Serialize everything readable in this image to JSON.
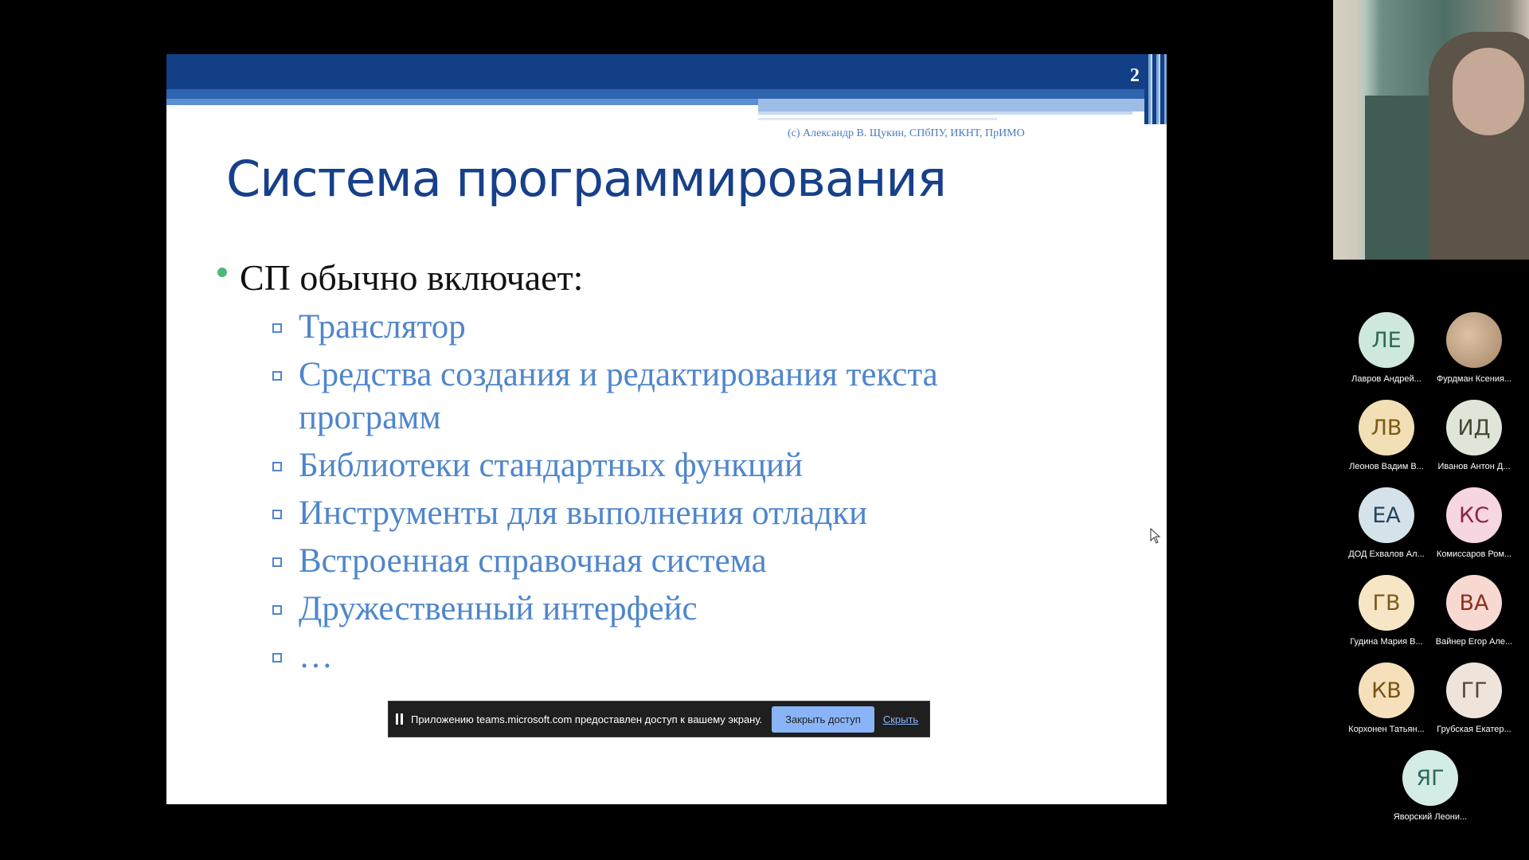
{
  "slide": {
    "number": "2",
    "copyright": "(c) Александр В. Щукин, СПбПУ, ИКНТ, ПрИМО",
    "title": "Система программирования",
    "bullet": "СП обычно включает:",
    "subitems": [
      "Транслятор",
      "Средства создания и редактирования текста программ",
      "Библиотеки стандартных функций",
      "Инструменты для выполнения отладки",
      "Встроенная справочная система",
      "Дружественный интерфейс",
      "…"
    ]
  },
  "share_banner": {
    "message": "Приложению teams.microsoft.com предоставлен доступ к вашему экрану.",
    "stop_label": "Закрыть доступ",
    "hide_label": "Скрыть"
  },
  "participants": [
    {
      "initials": "ЛЕ",
      "name": "Лавров Андрей...",
      "bg": "#cfe8dc",
      "fg": "#2c6a55"
    },
    {
      "initials": "",
      "name": "Фурдман Ксения...",
      "bg": "#c7aa8e",
      "fg": "#5a4631"
    },
    {
      "initials": "ЛВ",
      "name": "Леонов Вадим В...",
      "bg": "#f3dfb5",
      "fg": "#7a5a15"
    },
    {
      "initials": "ИД",
      "name": "Иванов Антон Д...",
      "bg": "#dfe5d8",
      "fg": "#3f4b34"
    },
    {
      "initials": "ЕА",
      "name": "ДОД Ехвалов Ал...",
      "bg": "#d6e2ea",
      "fg": "#24465e"
    },
    {
      "initials": "КС",
      "name": "Комиссаров Ром...",
      "bg": "#f6d6e0",
      "fg": "#8a2346"
    },
    {
      "initials": "ГВ",
      "name": "Гудина Мария В...",
      "bg": "#f7e6c6",
      "fg": "#7b5a1c"
    },
    {
      "initials": "ВА",
      "name": "Вайнер Егор Але...",
      "bg": "#f7d9d2",
      "fg": "#8c2f1e"
    },
    {
      "initials": "КВ",
      "name": "Корхонен Татьян...",
      "bg": "#f6e0bb",
      "fg": "#7a5316"
    },
    {
      "initials": "ГГ",
      "name": "Грубская Екатер...",
      "bg": "#eee4dc",
      "fg": "#5a4638"
    },
    {
      "initials": "ЯГ",
      "name": "Яворский Леони...",
      "bg": "#d4ece6",
      "fg": "#2c6a5f"
    }
  ]
}
